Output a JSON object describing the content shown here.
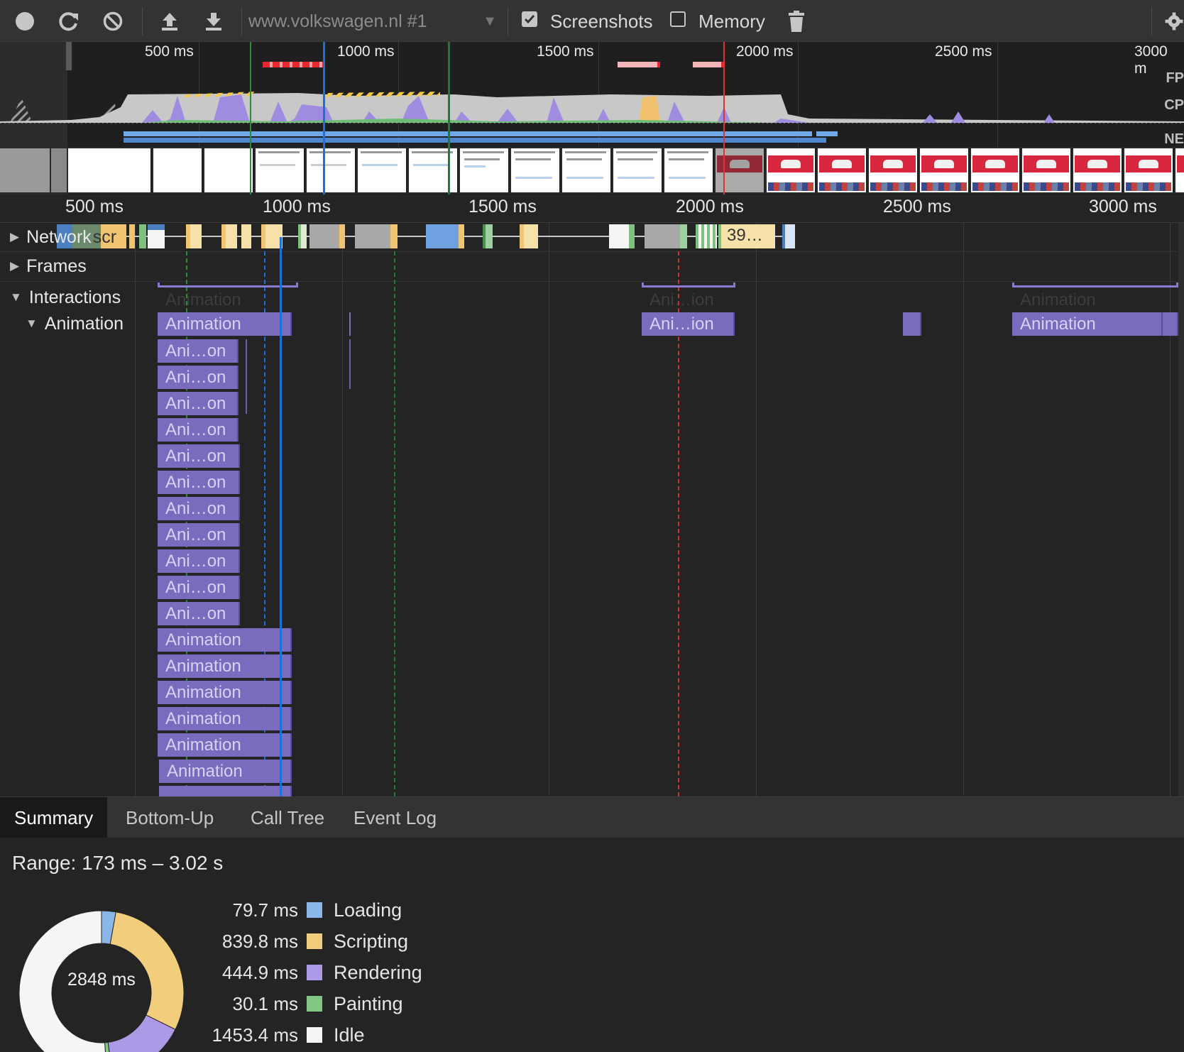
{
  "toolbar": {
    "record_icon": "record-icon",
    "reload_icon": "reload-icon",
    "clear_icon": "clear-icon",
    "upload_icon": "upload-icon",
    "download_icon": "download-icon",
    "profile_selected": "www.volkswagen.nl #1",
    "screenshots_label": "Screenshots",
    "screenshots_checked": true,
    "memory_label": "Memory",
    "memory_checked": false,
    "trash_icon": "trash-icon",
    "settings_icon": "gear-icon"
  },
  "overview": {
    "ticks": [
      "500 ms",
      "1000 ms",
      "1500 ms",
      "2000 ms",
      "2500 ms",
      "3000 m"
    ],
    "row_labels": [
      "FP",
      "CP",
      "NE"
    ]
  },
  "flamechart": {
    "ticks": [
      "500 ms",
      "1000 ms",
      "1500 ms",
      "2000 ms",
      "2500 ms",
      "3000 ms"
    ],
    "network_label": "Network",
    "network_overlay_text": "scr",
    "network_request_label": "39…",
    "frames_label": "Frames",
    "interactions_label": "Interactions",
    "animation_label": "Animation",
    "interaction_ghost_labels": [
      "Animation",
      "Ani…ion",
      "Animation"
    ],
    "top_row_labels": [
      "Animation",
      "Ani…ion",
      "Animation"
    ],
    "short_label": "Ani…on",
    "long_label": "Animation"
  },
  "tabs": [
    "Summary",
    "Bottom-Up",
    "Call Tree",
    "Event Log"
  ],
  "summary": {
    "range": "Range: 173 ms – 3.02 s",
    "total": "2848 ms",
    "legend": [
      {
        "value": "79.7 ms",
        "label": "Loading",
        "color": "#8bb6e8"
      },
      {
        "value": "839.8 ms",
        "label": "Scripting",
        "color": "#f2cd7c"
      },
      {
        "value": "444.9 ms",
        "label": "Rendering",
        "color": "#ad9ae6"
      },
      {
        "value": "30.1 ms",
        "label": "Painting",
        "color": "#81c784"
      },
      {
        "value": "1453.4 ms",
        "label": "Idle",
        "color": "#f5f5f5"
      }
    ]
  }
}
